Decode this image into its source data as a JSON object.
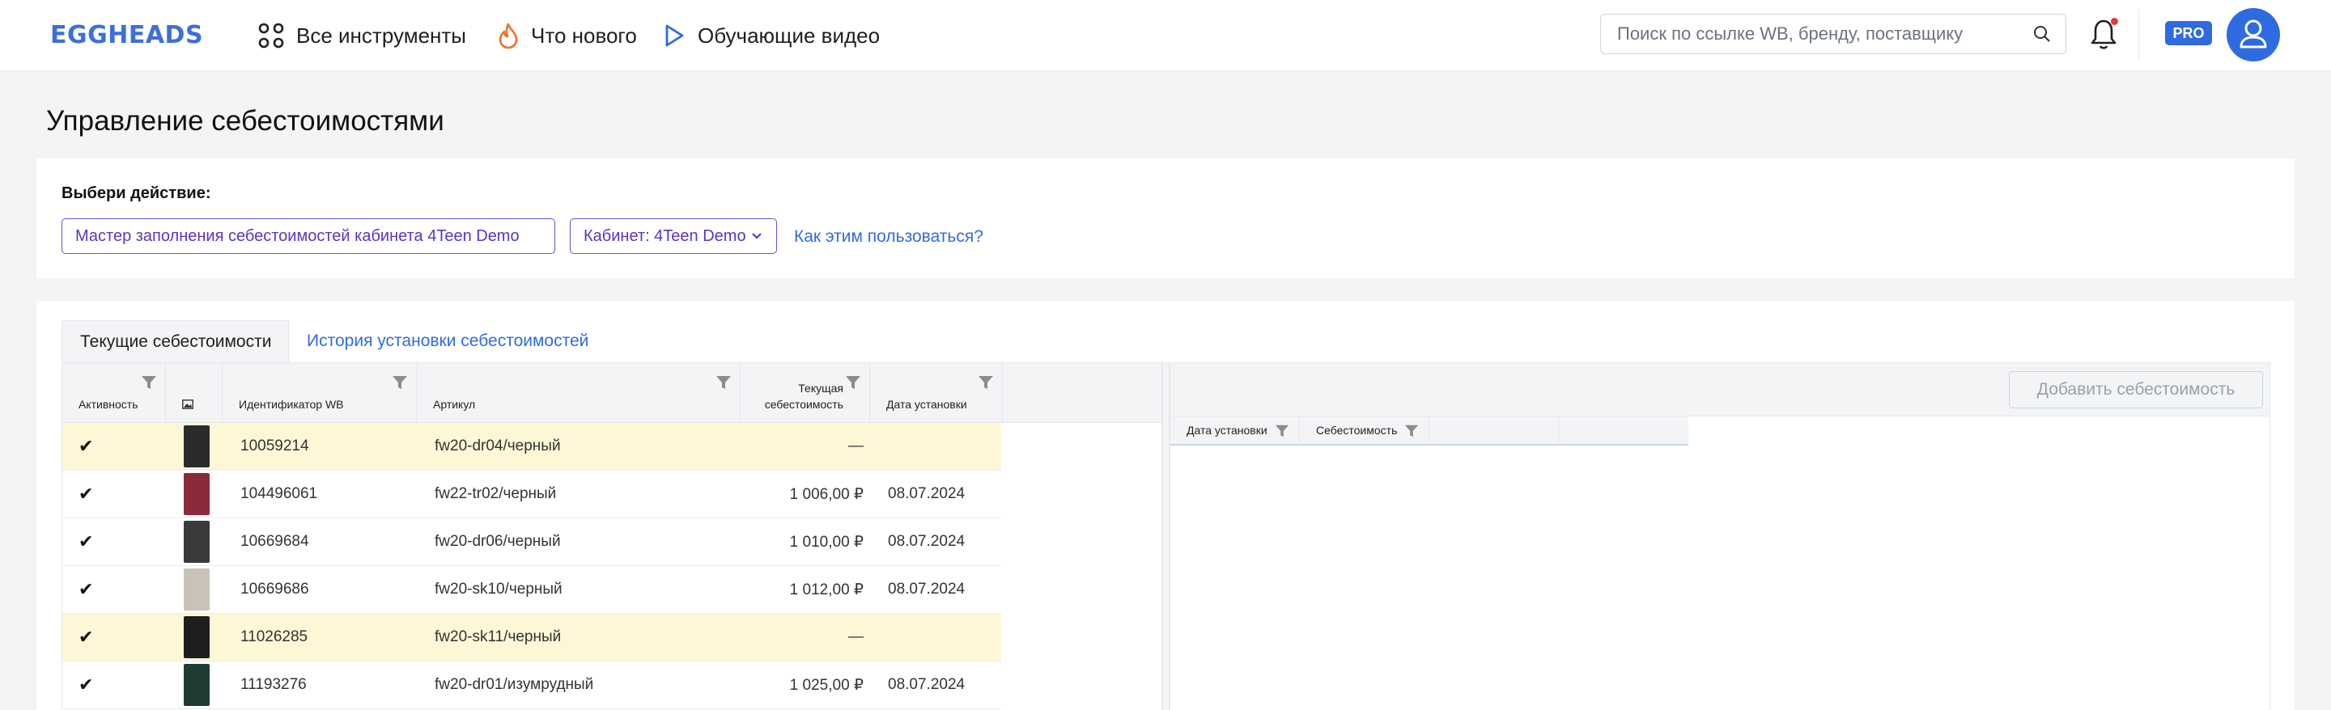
{
  "header": {
    "logo": "EGGHEADS",
    "nav": [
      {
        "label": "Все инструменты",
        "icon": "grid-icon"
      },
      {
        "label": "Что нового",
        "icon": "fire-icon"
      },
      {
        "label": "Обучающие видео",
        "icon": "play-icon"
      }
    ],
    "search_placeholder": "Поиск по ссылке WB, бренду, поставщику",
    "pro_badge": "PRO"
  },
  "page": {
    "title": "Управление себестоимостями"
  },
  "actions": {
    "label": "Выбери действие:",
    "wizard_button": "Мастер заполнения себестоимостей кабинета 4Teen Demo",
    "cabinet_select": "Кабинет: 4Teen Demo",
    "help_link": "Как этим пользоваться?"
  },
  "tabs": [
    {
      "label": "Текущие себестоимости",
      "active": true
    },
    {
      "label": "История установки себестоимостей",
      "active": false
    }
  ],
  "left_table": {
    "columns": [
      "Активность",
      "",
      "Идентификатор WB",
      "Артикул",
      "Текущая себестоимость",
      "Дата установки"
    ],
    "rows": [
      {
        "active": "✔",
        "id": "10059214",
        "article": "fw20-dr04/черный",
        "cost": "—",
        "date": "",
        "highlight": true,
        "thumb": "#2b2b2b"
      },
      {
        "active": "✔",
        "id": "104496061",
        "article": "fw22-tr02/черный",
        "cost": "1 006,00 ₽",
        "date": "08.07.2024",
        "highlight": false,
        "thumb": "#8a2a3a"
      },
      {
        "active": "✔",
        "id": "10669684",
        "article": "fw20-dr06/черный",
        "cost": "1 010,00 ₽",
        "date": "08.07.2024",
        "highlight": false,
        "thumb": "#3a3a3a"
      },
      {
        "active": "✔",
        "id": "10669686",
        "article": "fw20-sk10/черный",
        "cost": "1 012,00 ₽",
        "date": "08.07.2024",
        "highlight": false,
        "thumb": "#c9c2b6"
      },
      {
        "active": "✔",
        "id": "11026285",
        "article": "fw20-sk11/черный",
        "cost": "—",
        "date": "",
        "highlight": true,
        "thumb": "#1e1e1e"
      },
      {
        "active": "✔",
        "id": "11193276",
        "article": "fw20-dr01/изумрудный",
        "cost": "1 025,00 ₽",
        "date": "08.07.2024",
        "highlight": false,
        "thumb": "#1f3b33"
      }
    ]
  },
  "right_table": {
    "add_button": "Добавить себестоимость",
    "columns": [
      "Дата установки",
      "Себестоимость",
      ""
    ]
  },
  "colors": {
    "accent": "#2f6be0",
    "purple": "#5a35c4",
    "highlight_row": "#fdf7d5"
  }
}
